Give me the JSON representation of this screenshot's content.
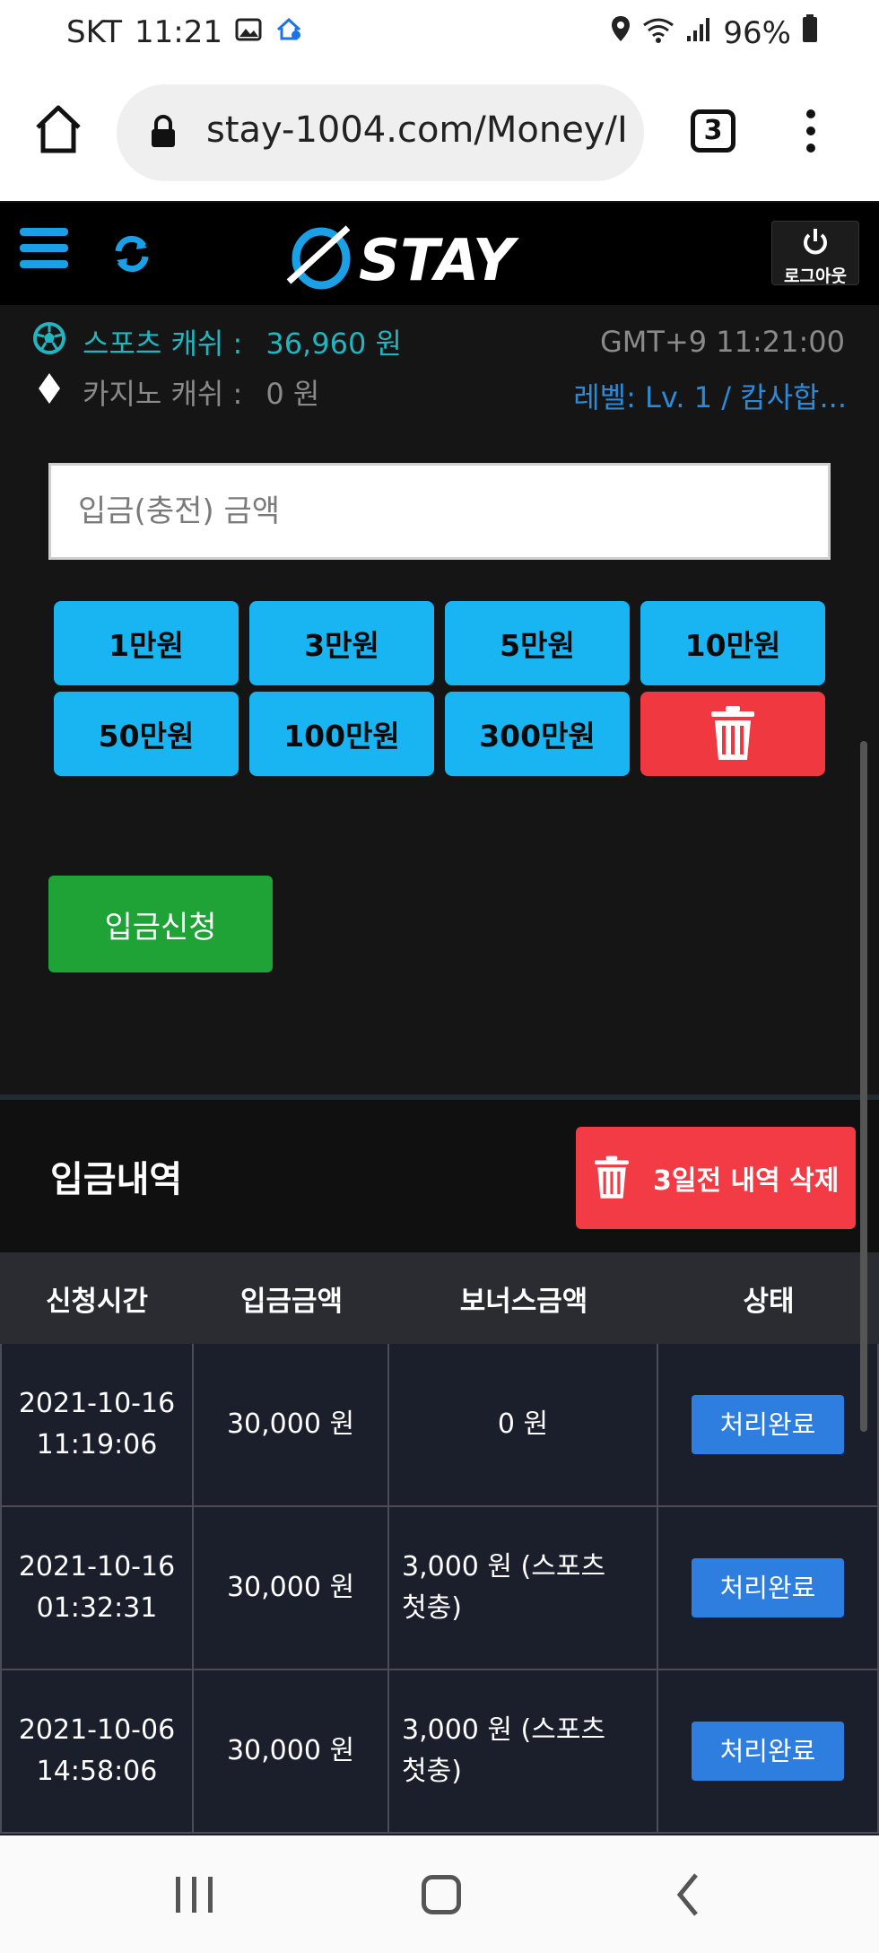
{
  "status_bar": {
    "carrier": "SKT",
    "time": "11:21",
    "battery": "96%"
  },
  "browser": {
    "url": "stay-1004.com/Money/I",
    "tab_count": "3"
  },
  "header": {
    "logo_text": "STAY",
    "logout_label": "로그아웃",
    "accent_color": "#1aa0e6"
  },
  "info": {
    "sports_label": "스포츠 캐쉬 :",
    "sports_value": "36,960 원",
    "casino_label": "카지노 캐쉬 :",
    "casino_value": "0 원",
    "clock": "GMT+9 11:21:00",
    "level": "레벨: Lv. 1 / 캄사합..."
  },
  "deposit_form": {
    "amount_placeholder": "입금(충전) 금액",
    "amount_buttons": [
      "1만원",
      "3만원",
      "5만원",
      "10만원",
      "50만원",
      "100만원",
      "300만원"
    ],
    "submit_label": "입금신청"
  },
  "history": {
    "title": "입금내역",
    "clear_label": "3일전 내역 삭제",
    "columns": [
      "신청시간",
      "입금금액",
      "보너스금액",
      "상태"
    ],
    "rows": [
      {
        "date": "2021-10-16",
        "time": "11:19:06",
        "amount": "30,000 원",
        "bonus": "0 원",
        "status": "처리완료"
      },
      {
        "date": "2021-10-16",
        "time": "01:32:31",
        "amount": "30,000 원",
        "bonus": "3,000 원 (스포츠 첫충)",
        "status": "처리완료"
      },
      {
        "date": "2021-10-06",
        "time": "14:58:06",
        "amount": "30,000 원",
        "bonus": "3,000 원 (스포츠 첫충)",
        "status": "처리완료"
      }
    ]
  }
}
